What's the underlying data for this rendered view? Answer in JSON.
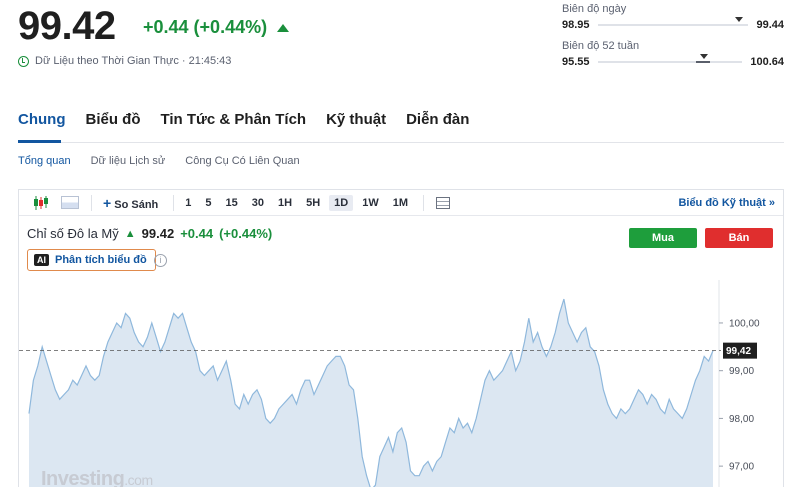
{
  "quote": {
    "price": "99.42",
    "change": "+0.44 (+0.44%)",
    "realtime": "Dữ Liệu theo Thời Gian Thực · 21:45:43"
  },
  "ranges": {
    "daily_label": "Biên độ ngày",
    "daily_low": "98.95",
    "daily_high": "99.44",
    "year_label": "Biên độ 52 tuần",
    "year_low": "95.55",
    "year_high": "100.64"
  },
  "tabs": [
    "Chung",
    "Biểu đồ",
    "Tin Tức & Phân Tích",
    "Kỹ thuật",
    "Diễn đàn"
  ],
  "subtabs": [
    "Tổng quan",
    "Dữ liệu Lịch sử",
    "Công Cụ Có Liên Quan"
  ],
  "toolbar": {
    "compare": "So Sánh",
    "intervals": [
      "1",
      "5",
      "15",
      "30",
      "1H",
      "5H",
      "1D",
      "1W",
      "1M"
    ],
    "active_interval": "1D",
    "tech_chart": "Biểu đồ Kỹ thuật »"
  },
  "instrument": {
    "name": "Chỉ số Đô la Mỹ",
    "price": "99.42",
    "change": "+0.44",
    "change_pct": "(+0.44%)"
  },
  "ai_button": {
    "badge": "AI",
    "label": "Phân tích biểu đồ"
  },
  "actions": {
    "buy": "Mua",
    "sell": "Bán"
  },
  "watermark": {
    "brand": "Investing",
    "suffix": ".com"
  },
  "colors": {
    "positive": "#1a8f3c",
    "accent": "#1256a0",
    "buy": "#1e9e3c",
    "sell": "#e02e2e",
    "line": "#8fb8dc",
    "area": "#dce7f2"
  },
  "chart_data": {
    "type": "area",
    "y_ticks": [
      "100,00",
      "99,00",
      "98,00",
      "97,00"
    ],
    "y_tick_values": [
      100,
      99,
      98,
      97
    ],
    "current_label": "99,42",
    "current_value": 99.42,
    "ylim": [
      96.5,
      100.9
    ],
    "grid": false,
    "values": [
      98.1,
      98.8,
      99.1,
      99.5,
      99.2,
      98.9,
      98.6,
      98.4,
      98.5,
      98.6,
      98.8,
      98.7,
      98.9,
      99.1,
      98.9,
      98.8,
      98.9,
      99.3,
      99.6,
      99.8,
      100.0,
      99.9,
      100.2,
      100.1,
      99.8,
      99.6,
      99.5,
      99.7,
      100.0,
      99.7,
      99.4,
      99.6,
      99.9,
      100.2,
      100.1,
      100.2,
      99.9,
      99.6,
      99.4,
      99.0,
      98.9,
      99.0,
      99.1,
      98.8,
      99.0,
      99.2,
      98.8,
      98.3,
      98.2,
      98.5,
      98.3,
      98.5,
      98.6,
      98.4,
      98.0,
      97.9,
      98.0,
      98.2,
      98.3,
      98.4,
      98.5,
      98.3,
      98.6,
      98.8,
      98.8,
      98.5,
      98.7,
      98.9,
      99.1,
      99.2,
      99.3,
      99.3,
      99.1,
      98.7,
      98.6,
      98.0,
      97.2,
      96.8,
      96.5,
      96.6,
      97.2,
      97.4,
      97.6,
      97.3,
      97.7,
      97.8,
      97.5,
      96.9,
      96.8,
      96.8,
      97.0,
      97.1,
      96.9,
      97.1,
      97.2,
      97.5,
      97.8,
      97.7,
      98.0,
      97.8,
      97.9,
      97.7,
      98.0,
      98.4,
      98.8,
      99.0,
      98.8,
      98.9,
      99.0,
      99.2,
      99.4,
      99.0,
      99.2,
      99.6,
      100.1,
      99.6,
      99.8,
      99.5,
      99.3,
      99.5,
      99.8,
      100.2,
      100.5,
      100.0,
      99.8,
      99.6,
      99.8,
      99.9,
      99.5,
      99.4,
      99.1,
      98.6,
      98.3,
      98.1,
      98.0,
      98.2,
      98.1,
      98.2,
      98.4,
      98.6,
      98.5,
      98.3,
      98.5,
      98.4,
      98.2,
      98.1,
      98.4,
      98.2,
      98.1,
      98.0,
      98.2,
      98.5,
      98.8,
      99.0,
      99.3,
      99.2,
      99.42
    ]
  }
}
